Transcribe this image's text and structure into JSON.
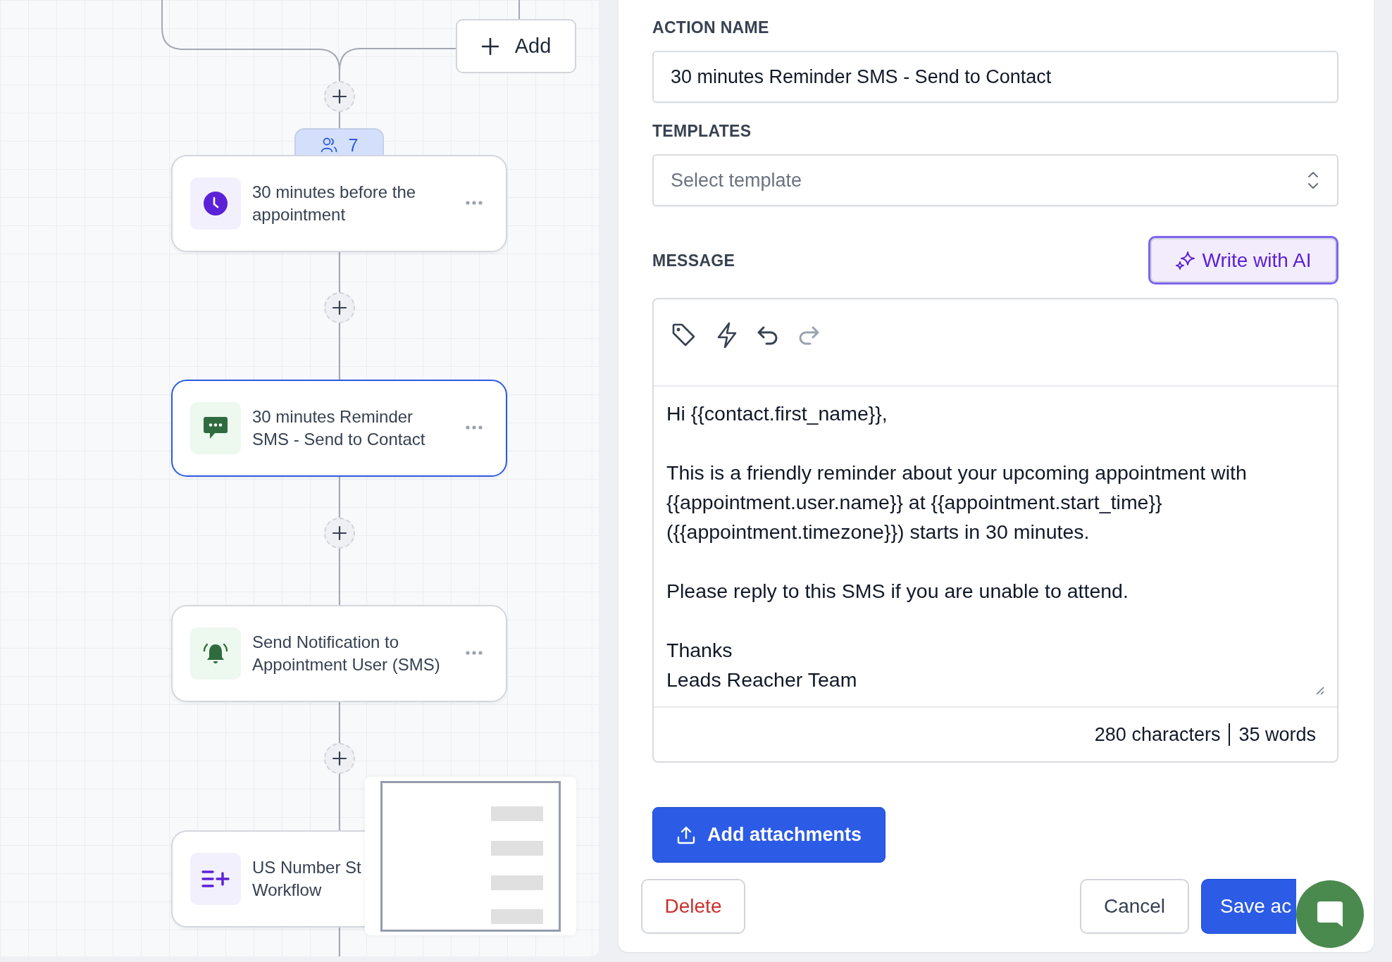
{
  "canvas": {
    "add_button": {
      "label": "Add"
    },
    "badge": {
      "count": "7"
    },
    "nodes": [
      {
        "kind": "timer",
        "title": "30 minutes before the\nappointment",
        "selected": false
      },
      {
        "kind": "sms",
        "title": "30 minutes Reminder\nSMS - Send to Contact",
        "selected": true
      },
      {
        "kind": "notification",
        "title": "Send Notification to\nAppointment User (SMS)",
        "selected": false
      },
      {
        "kind": "workflow",
        "title": "US Number St\nWorkflow",
        "selected": false
      }
    ]
  },
  "panel": {
    "action_name": {
      "label": "ACTION NAME",
      "value": "30 minutes Reminder SMS - Send to Contact"
    },
    "templates": {
      "label": "TEMPLATES",
      "placeholder": "Select template"
    },
    "message": {
      "label": "MESSAGE",
      "ai_button": "Write with AI",
      "toolbar": [
        {
          "kind": "tag",
          "disabled": false
        },
        {
          "kind": "bolt",
          "disabled": false
        },
        {
          "kind": "undo",
          "disabled": false
        },
        {
          "kind": "redo",
          "disabled": true
        }
      ],
      "value": "Hi {{contact.first_name}},\n\nThis is a friendly reminder about your upcoming appointment with\n{{appointment.user.name}} at {{appointment.start_time}}\n({{appointment.timezone}}) starts in 30 minutes.\n\nPlease reply to this SMS if you are unable to attend.\n\nThanks\nLeads Reacher Team",
      "characters": "280 characters",
      "words": "35 words"
    },
    "attach_button": "Add attachments",
    "delete_button": "Delete",
    "cancel_button": "Cancel",
    "save_button": "Save ac"
  }
}
